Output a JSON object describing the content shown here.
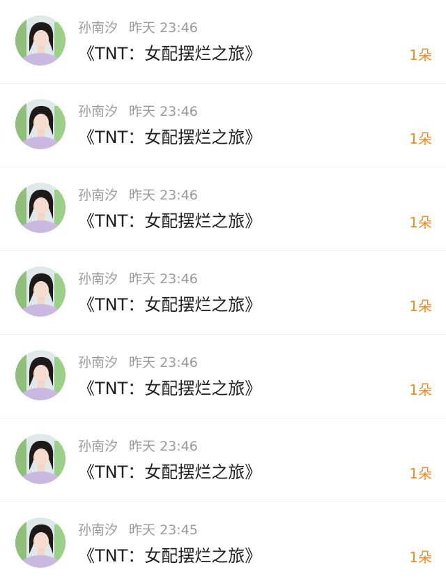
{
  "colors": {
    "accent_orange": "#f28a1e",
    "meta_gray": "#9a9a9a",
    "title_black": "#1f1f1f",
    "divider": "#efefef"
  },
  "items": [
    {
      "name": "孙南汐",
      "date": "昨天",
      "time": "23:46",
      "title": "《TNT：女配摆烂之旅》",
      "gift": "1朵",
      "avatar_icon": "user-avatar-icon"
    },
    {
      "name": "孙南汐",
      "date": "昨天",
      "time": "23:46",
      "title": "《TNT：女配摆烂之旅》",
      "gift": "1朵",
      "avatar_icon": "user-avatar-icon"
    },
    {
      "name": "孙南汐",
      "date": "昨天",
      "time": "23:46",
      "title": "《TNT：女配摆烂之旅》",
      "gift": "1朵",
      "avatar_icon": "user-avatar-icon"
    },
    {
      "name": "孙南汐",
      "date": "昨天",
      "time": "23:46",
      "title": "《TNT：女配摆烂之旅》",
      "gift": "1朵",
      "avatar_icon": "user-avatar-icon"
    },
    {
      "name": "孙南汐",
      "date": "昨天",
      "time": "23:46",
      "title": "《TNT：女配摆烂之旅》",
      "gift": "1朵",
      "avatar_icon": "user-avatar-icon"
    },
    {
      "name": "孙南汐",
      "date": "昨天",
      "time": "23:46",
      "title": "《TNT：女配摆烂之旅》",
      "gift": "1朵",
      "avatar_icon": "user-avatar-icon"
    },
    {
      "name": "孙南汐",
      "date": "昨天",
      "time": "23:45",
      "title": "《TNT：女配摆烂之旅》",
      "gift": "1朵",
      "avatar_icon": "user-avatar-icon"
    }
  ]
}
